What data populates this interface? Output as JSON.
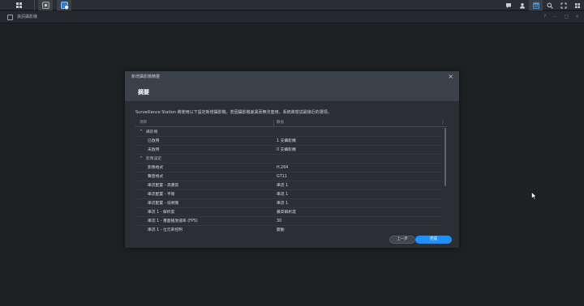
{
  "taskbar": {
    "apps": [
      {
        "icon": "grid-menu-icon"
      },
      {
        "icon": "app-window-icon"
      },
      {
        "icon": "surveillance-station-icon"
      }
    ],
    "right_icons": [
      "chat-icon",
      "user-icon",
      "widgets-icon",
      "search-icon",
      "fullscreen-icon",
      "options-icon"
    ]
  },
  "window": {
    "title": "資訊攝影機",
    "controls": [
      "?",
      "–",
      "□",
      "×"
    ]
  },
  "dialog": {
    "title": "新增攝影機精靈",
    "close": "×",
    "heading": "摘要",
    "description": "Surveillance Station 將使用以下設定新增攝影機。若因攝影機差異而無法套用，系統將嘗試最接近的選項。",
    "columns": [
      "項目",
      "數值"
    ],
    "rows": [
      {
        "type": "group",
        "label": "攝影機",
        "value": ""
      },
      {
        "type": "item",
        "label": "已啟用",
        "value": "1 支攝影機"
      },
      {
        "type": "item",
        "label": "未啟用",
        "value": "0 支攝影機"
      },
      {
        "type": "group",
        "label": "影像設定",
        "value": ""
      },
      {
        "type": "item",
        "label": "影像格式",
        "value": "H.264"
      },
      {
        "type": "item",
        "label": "聲音格式",
        "value": "G711"
      },
      {
        "type": "item",
        "label": "串流配置 - 高畫質",
        "value": "串流 1"
      },
      {
        "type": "item",
        "label": "串流配置 - 平衡",
        "value": "串流 1"
      },
      {
        "type": "item",
        "label": "串流配置 - 低頻寬",
        "value": "串流 1"
      },
      {
        "type": "item",
        "label": "串流 1 - 解析度",
        "value": "最高解析度"
      },
      {
        "type": "item",
        "label": "串流 1 - 畫面播放速率 (FPS)",
        "value": "30"
      },
      {
        "type": "item",
        "label": "串流 1 - 位元率控制",
        "value": "變動"
      }
    ],
    "buttons": {
      "prev": "上一步",
      "done": "完成"
    }
  }
}
